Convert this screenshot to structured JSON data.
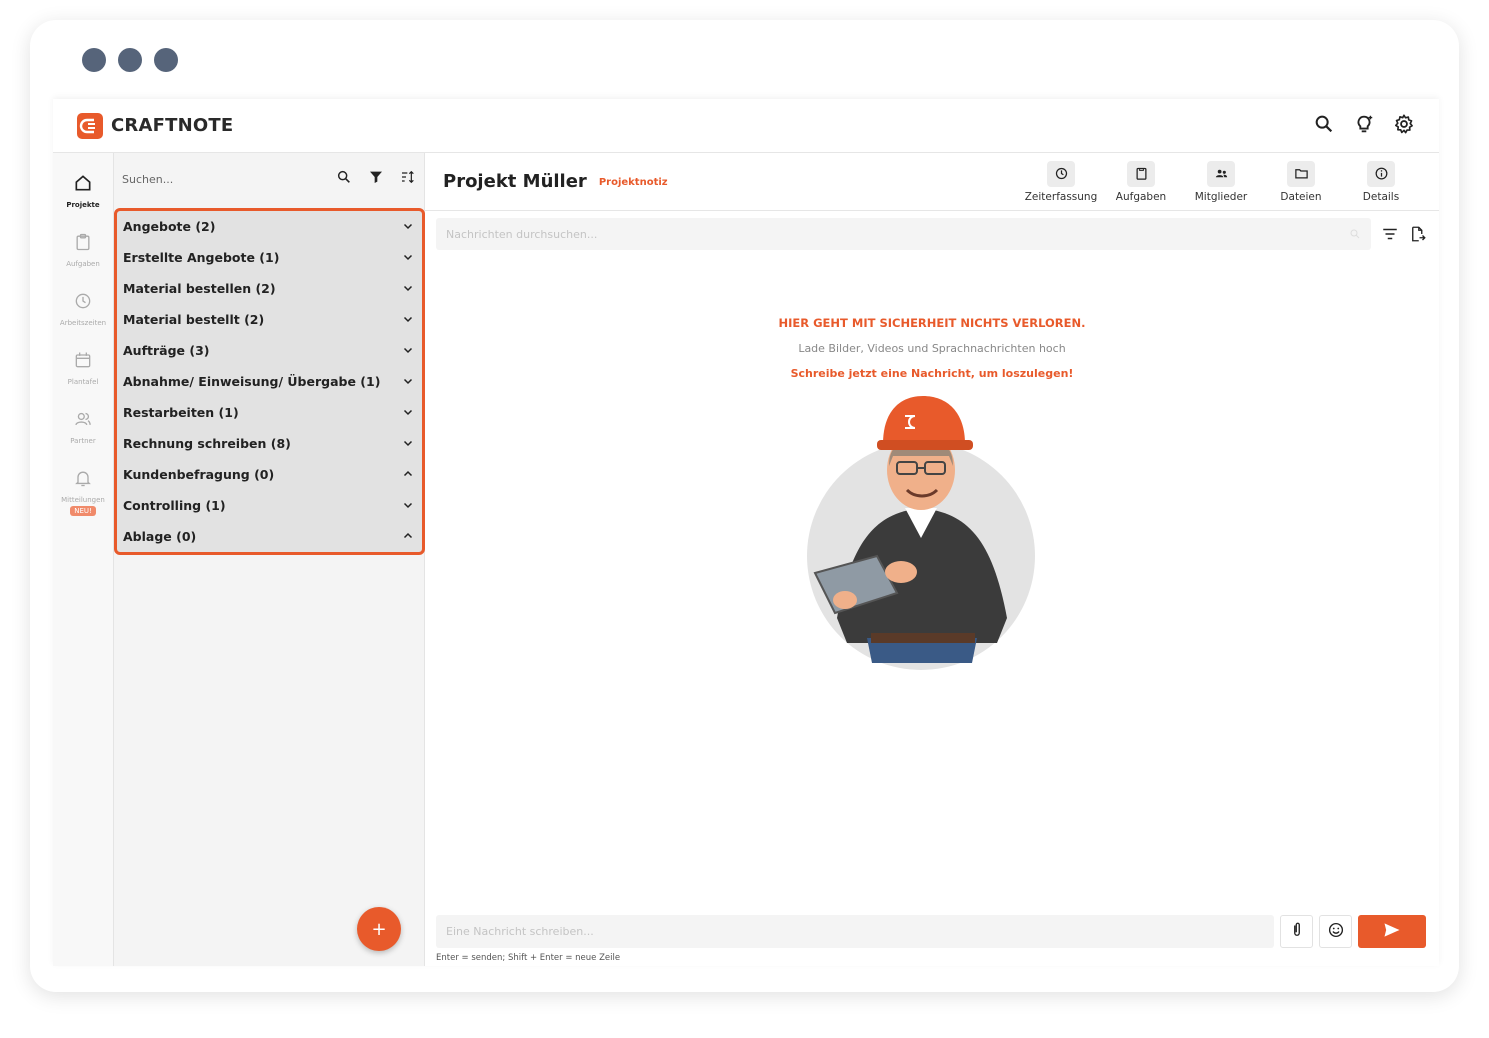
{
  "colors": {
    "accent": "#e85a2b",
    "window_dots": "#56647a"
  },
  "app": {
    "brand": "CRAFTNOTE"
  },
  "nav": [
    {
      "label": "Projekte",
      "icon": "home-icon"
    },
    {
      "label": "Aufgaben",
      "icon": "clipboard-icon"
    },
    {
      "label": "Arbeitszeiten",
      "icon": "clock-icon"
    },
    {
      "label": "Plantafel",
      "icon": "calendar-icon"
    },
    {
      "label": "Partner",
      "icon": "users-icon"
    },
    {
      "label": "Mitteilungen",
      "icon": "bell-icon",
      "badge": "NEU!"
    }
  ],
  "list": {
    "search_placeholder": "Suchen...",
    "categories": [
      {
        "label": "Angebote (2)",
        "state": "collapsed"
      },
      {
        "label": "Erstellte Angebote (1)",
        "state": "collapsed"
      },
      {
        "label": "Material bestellen (2)",
        "state": "collapsed"
      },
      {
        "label": "Material bestellt (2)",
        "state": "collapsed"
      },
      {
        "label": "Aufträge (3)",
        "state": "collapsed"
      },
      {
        "label": "Abnahme/ Einweisung/ Übergabe (1)",
        "state": "collapsed"
      },
      {
        "label": "Restarbeiten (1)",
        "state": "collapsed"
      },
      {
        "label": "Rechnung schreiben (8)",
        "state": "collapsed"
      },
      {
        "label": "Kundenbefragung (0)",
        "state": "expanded"
      },
      {
        "label": "Controlling (1)",
        "state": "collapsed"
      },
      {
        "label": "Ablage (0)",
        "state": "expanded"
      }
    ],
    "fab_label": "+"
  },
  "project": {
    "title": "Projekt Müller",
    "tag": "Projektnotiz",
    "tools": [
      {
        "label": "Zeiterfassung",
        "icon": "clock-icon"
      },
      {
        "label": "Aufgaben",
        "icon": "clipboard-icon"
      },
      {
        "label": "Mitglieder",
        "icon": "members-icon"
      },
      {
        "label": "Dateien",
        "icon": "folder-icon"
      },
      {
        "label": "Details",
        "icon": "info-icon"
      }
    ]
  },
  "chat": {
    "search_placeholder": "Nachrichten durchsuchen...",
    "empty_title": "HIER GEHT MIT SICHERHEIT NICHTS VERLOREN.",
    "empty_sub": "Lade Bilder, Videos und Sprachnachrichten hoch",
    "empty_cta": "Schreibe jetzt eine Nachricht, um loszulegen!",
    "compose_placeholder": "Eine Nachricht schreiben...",
    "hint": "Enter = senden; Shift + Enter = neue Zeile"
  }
}
